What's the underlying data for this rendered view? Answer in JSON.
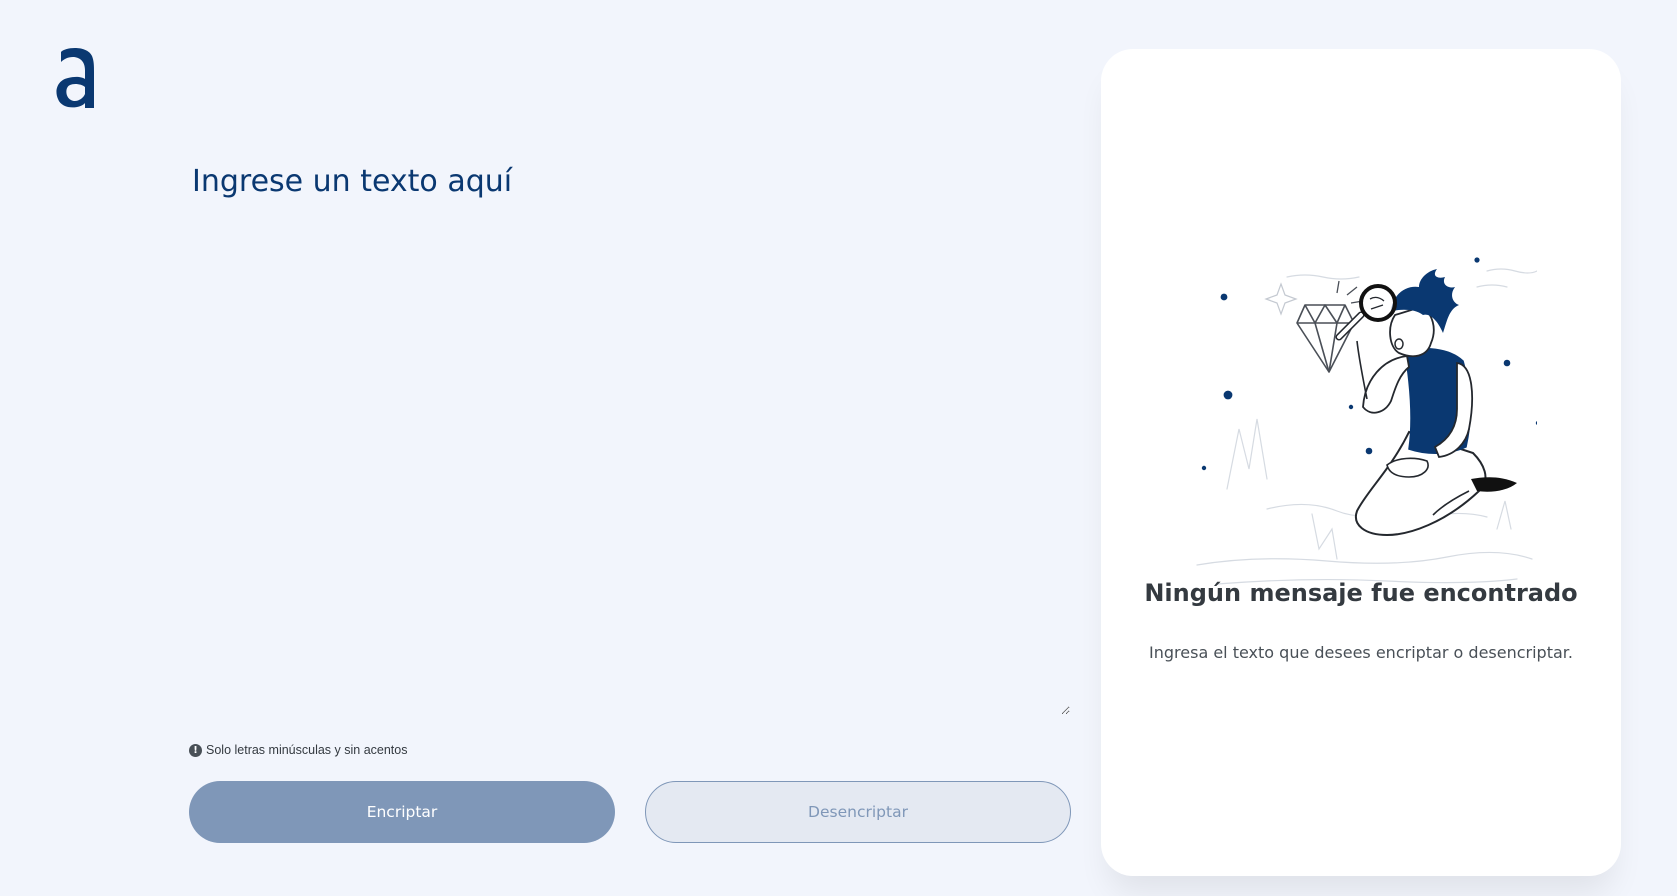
{
  "brand": {
    "logo_letter": "a",
    "primary_color": "#0a3871",
    "background_color": "#f2f5fc"
  },
  "input": {
    "placeholder": "Ingrese un texto aquí",
    "value": ""
  },
  "hint": {
    "icon": "exclamation-circle-icon",
    "text": "Solo letras minúsculas y sin acentos"
  },
  "buttons": {
    "encrypt_label": "Encriptar",
    "decrypt_label": "Desencriptar"
  },
  "result": {
    "illustration": "person-with-magnifier-diamond-illustration",
    "title": "Ningún mensaje fue encontrado",
    "description": "Ingresa el texto que desees encriptar o desencriptar."
  }
}
